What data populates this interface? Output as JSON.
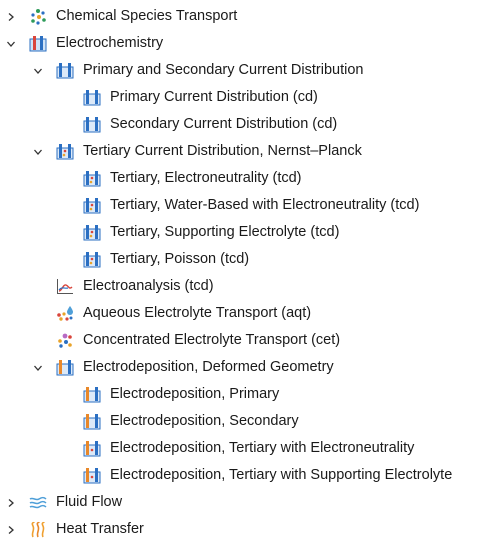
{
  "tree": {
    "items": [
      {
        "label": "Chemical Species Transport",
        "icon": "chemical-species-icon",
        "expanded": false
      },
      {
        "label": "Electrochemistry",
        "icon": "electrochemistry-icon",
        "expanded": true
      },
      {
        "label": "Primary and Secondary Current Distribution",
        "icon": "current-distribution-icon",
        "expanded": true
      },
      {
        "label": "Primary Current Distribution (cd)",
        "icon": "current-distribution-icon"
      },
      {
        "label": "Secondary Current Distribution (cd)",
        "icon": "current-distribution-icon"
      },
      {
        "label": "Tertiary Current Distribution, Nernst–Planck",
        "icon": "tertiary-distribution-icon",
        "expanded": true
      },
      {
        "label": "Tertiary, Electroneutrality (tcd)",
        "icon": "tertiary-distribution-icon"
      },
      {
        "label": "Tertiary, Water-Based with Electroneutrality (tcd)",
        "icon": "tertiary-distribution-icon"
      },
      {
        "label": "Tertiary, Supporting Electrolyte (tcd)",
        "icon": "tertiary-distribution-icon"
      },
      {
        "label": "Tertiary, Poisson (tcd)",
        "icon": "tertiary-distribution-icon"
      },
      {
        "label": "Electroanalysis (tcd)",
        "icon": "electroanalysis-icon"
      },
      {
        "label": "Aqueous Electrolyte Transport (aqt)",
        "icon": "aqueous-electrolyte-icon"
      },
      {
        "label": "Concentrated Electrolyte Transport (cet)",
        "icon": "concentrated-electrolyte-icon"
      },
      {
        "label": "Electrodeposition, Deformed Geometry",
        "icon": "electrodeposition-icon",
        "expanded": true
      },
      {
        "label": "Electrodeposition, Primary",
        "icon": "electrodeposition-icon"
      },
      {
        "label": "Electrodeposition, Secondary",
        "icon": "electrodeposition-icon"
      },
      {
        "label": "Electrodeposition, Tertiary with Electroneutrality",
        "icon": "electrodeposition-icon"
      },
      {
        "label": "Electrodeposition, Tertiary with Supporting Electrolyte",
        "icon": "electrodeposition-icon"
      },
      {
        "label": "Fluid Flow",
        "icon": "fluid-flow-icon",
        "expanded": false
      },
      {
        "label": "Heat Transfer",
        "icon": "heat-transfer-icon",
        "expanded": false
      }
    ]
  },
  "colors": {
    "electrode_blue": "#2b6fc2",
    "electrode_orange": "#e8882a",
    "cathode_red": "#d9453b",
    "fluid_blue": "#4f9fd8",
    "heat_orange": "#f0a030"
  }
}
